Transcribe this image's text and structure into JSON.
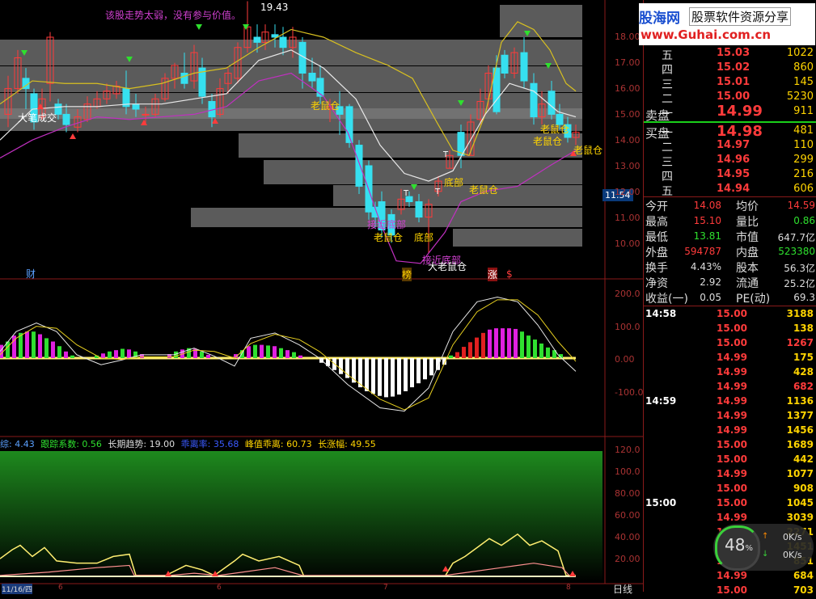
{
  "chart_header": {
    "warning_text": "该股走势太弱，没有参与价值。",
    "peak_label": "19.43",
    "last_price_tag": "11.54",
    "cross_label": "大笔成交",
    "caiwu_mark": "财",
    "bang_mark": "榜",
    "zhang_mark": "涨",
    "dollar_mark": "$"
  },
  "price_axis": [
    "18.00",
    "17.00",
    "16.00",
    "15.00",
    "14.00",
    "13.00",
    "12.00",
    "11.00",
    "10.00"
  ],
  "macd_axis": [
    "200.0",
    "100.0",
    "0.00",
    "-100.0"
  ],
  "indicator_axis": [
    "120.0",
    "100.0",
    "80.00",
    "60.00",
    "40.00",
    "20.00"
  ],
  "annotations": {
    "rat": "老鼠仓",
    "bottom": "底部",
    "near_bottom": "接近底部",
    "big_rat": "大老鼠仓",
    "t": "T"
  },
  "indicator_header": {
    "prefix": "综: 4.43",
    "track_label": "跟踪系数:",
    "track_value": "0.56",
    "trend_label": "长期趋势:",
    "trend_value": "19.00",
    "up_label": "乖离率:",
    "up_value": "35.68",
    "peak_label": "峰值乖离:",
    "peak_value": "60.73",
    "rise_label": "长涨幅:",
    "rise_value": "49.55"
  },
  "time_axis": [
    "11/16/四",
    "6",
    "6",
    "7",
    "8"
  ],
  "side_tab": "日线",
  "watermark": {
    "site": "股海网",
    "slogan": "股票软件资源分享",
    "url": "www.Guhai.com.cn"
  },
  "order_book": {
    "sell_label": "卖盘",
    "buy_label": "买盘",
    "sell": [
      {
        "level": "五",
        "price": "15.03",
        "vol": "1022"
      },
      {
        "level": "四",
        "price": "15.02",
        "vol": "860"
      },
      {
        "level": "三",
        "price": "15.01",
        "vol": "145"
      },
      {
        "level": "二",
        "price": "15.00",
        "vol": "5230"
      },
      {
        "level": "一",
        "price": "14.99",
        "vol": "911"
      }
    ],
    "buy": [
      {
        "level": "一",
        "price": "14.98",
        "vol": "481"
      },
      {
        "level": "二",
        "price": "14.97",
        "vol": "110"
      },
      {
        "level": "三",
        "price": "14.96",
        "vol": "299"
      },
      {
        "level": "四",
        "price": "14.95",
        "vol": "216"
      },
      {
        "level": "五",
        "price": "14.94",
        "vol": "606"
      }
    ]
  },
  "stats": [
    {
      "l1": "今开",
      "v1": "14.08",
      "l2": "均价",
      "v2": "14.59"
    },
    {
      "l1": "最高",
      "v1": "15.10",
      "l2": "量比",
      "v2": "0.86"
    },
    {
      "l1": "最低",
      "v1": "13.81",
      "l2": "市值",
      "v2": "647.7亿"
    },
    {
      "l1": "外盘",
      "v1": "594787",
      "l2": "内盘",
      "v2": "523380"
    },
    {
      "l1": "换手",
      "v1": "4.43%",
      "l2": "股本",
      "v2": "56.3亿"
    },
    {
      "l1": "净资",
      "v1": "2.92",
      "l2": "流通",
      "v2": "25.2亿"
    },
    {
      "l1": "收益(一)",
      "v1": "0.05",
      "l2": "PE(动)",
      "v2": "69.3"
    }
  ],
  "ticks": [
    {
      "time": "14:58",
      "price": "15.00",
      "vol": "3188",
      "c": "#ffd400"
    },
    {
      "time": "",
      "price": "15.00",
      "vol": "138",
      "c": "#ffd400"
    },
    {
      "time": "",
      "price": "15.00",
      "vol": "1267",
      "c": "#ff3b3b"
    },
    {
      "time": "",
      "price": "14.99",
      "vol": "175",
      "c": "#ffd400"
    },
    {
      "time": "",
      "price": "14.99",
      "vol": "428",
      "c": "#ffd400"
    },
    {
      "time": "",
      "price": "14.99",
      "vol": "682",
      "c": "#ff3b3b"
    },
    {
      "time": "14:59",
      "price": "14.99",
      "vol": "1136",
      "c": "#ffd400"
    },
    {
      "time": "",
      "price": "14.99",
      "vol": "1377",
      "c": "#ffd400"
    },
    {
      "time": "",
      "price": "14.99",
      "vol": "1456",
      "c": "#ffd400"
    },
    {
      "time": "",
      "price": "15.00",
      "vol": "1689",
      "c": "#ffd400"
    },
    {
      "time": "",
      "price": "15.00",
      "vol": "442",
      "c": "#ffd400"
    },
    {
      "time": "",
      "price": "14.99",
      "vol": "1077",
      "c": "#ffd400"
    },
    {
      "time": "",
      "price": "15.00",
      "vol": "908",
      "c": "#ffd400"
    },
    {
      "time": "15:00",
      "price": "15.00",
      "vol": "1045",
      "c": "#ffd400"
    },
    {
      "time": "",
      "price": "14.99",
      "vol": "3039",
      "c": "#ffd400"
    },
    {
      "time": "",
      "price": "15.00",
      "vol": "2271",
      "c": "#ffd400"
    },
    {
      "time": "",
      "price": "15.00",
      "vol": "1451",
      "c": "#ffd400"
    },
    {
      "time": "",
      "price": "14.99",
      "vol": "851",
      "c": "#ffd400"
    },
    {
      "time": "",
      "price": "14.99",
      "vol": "684",
      "c": "#ffd400"
    },
    {
      "time": "",
      "price": "15.00",
      "vol": "703",
      "c": "#ffd400"
    }
  ],
  "net_widget": {
    "percent": "48",
    "pct_sign": "%",
    "up": "0K/s",
    "down": "0K/s"
  }
}
